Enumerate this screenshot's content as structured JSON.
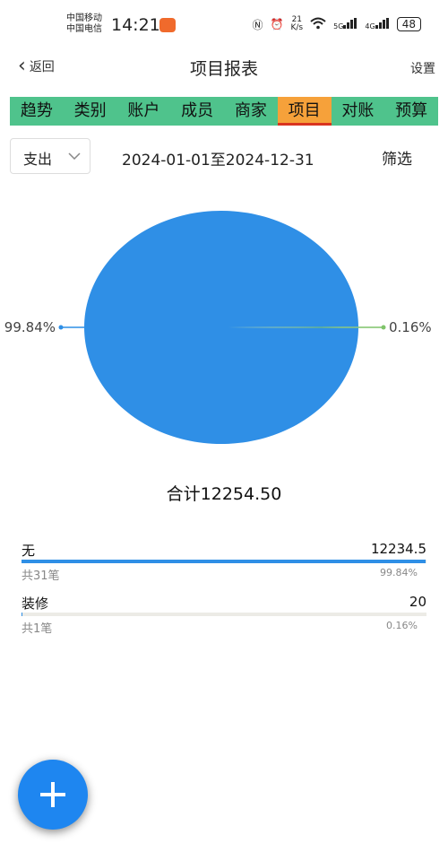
{
  "status_bar": {
    "carrier1": "中国移动",
    "carrier2": "中国电信",
    "time": "14:21",
    "net_speed_value": "21",
    "net_speed_unit": "K/s",
    "net_5g": "5G",
    "net_4g": "4G",
    "battery": "48"
  },
  "header": {
    "back_label": "返回",
    "title": "项目报表",
    "settings_label": "设置"
  },
  "tabs": [
    {
      "label": "趋势",
      "active": false
    },
    {
      "label": "类别",
      "active": false
    },
    {
      "label": "账户",
      "active": false
    },
    {
      "label": "成员",
      "active": false
    },
    {
      "label": "商家",
      "active": false
    },
    {
      "label": "项目",
      "active": true
    },
    {
      "label": "对账",
      "active": false
    },
    {
      "label": "预算",
      "active": false
    }
  ],
  "filters": {
    "type_value": "支出",
    "date_range": "2024-01-01至2024-12-31",
    "filter_label": "筛选"
  },
  "chart_data": {
    "type": "pie",
    "categories": [
      "无",
      "装修"
    ],
    "values": [
      12234.5,
      20
    ],
    "labels": [
      "99.84%",
      "0.16%"
    ],
    "colors": [
      "#2f8fe6",
      "#7fc46a"
    ]
  },
  "summary": {
    "total_label": "合计12254.50"
  },
  "items": [
    {
      "name": "无",
      "amount": "12234.5",
      "count": "共31笔",
      "percent": "99.84%",
      "share": 0.9984
    },
    {
      "name": "装修",
      "amount": "20",
      "count": "共1笔",
      "percent": "0.16%",
      "share": 0.0016
    }
  ],
  "colors": {
    "tab_bar": "#4fc38c",
    "tab_active": "#f6a13a",
    "tab_indicator": "#d9341f",
    "accent": "#1e86f0"
  },
  "fab": {
    "icon": "plus-icon"
  }
}
